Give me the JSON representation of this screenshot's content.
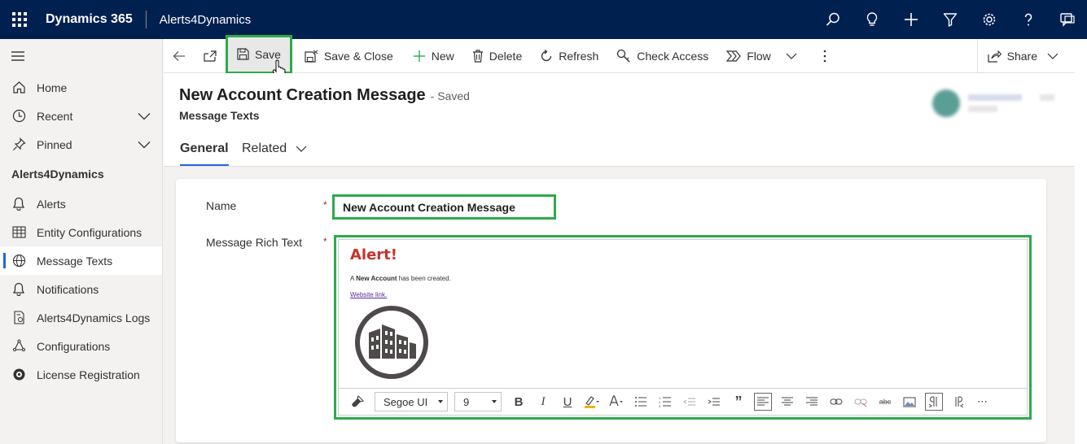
{
  "app": {
    "product": "Dynamics 365",
    "name": "Alerts4Dynamics"
  },
  "top_icons": [
    "search-icon",
    "lightbulb-icon",
    "plus-icon",
    "filter-icon",
    "settings-icon",
    "help-icon",
    "chat-icon"
  ],
  "commands": {
    "back": "back-arrow-icon",
    "popout": "popout-icon",
    "save": "Save",
    "save_close": "Save & Close",
    "new": "New",
    "delete": "Delete",
    "refresh": "Refresh",
    "check_access": "Check Access",
    "flow": "Flow",
    "share": "Share"
  },
  "sidebar": {
    "items_top": [
      {
        "label": "Home",
        "icon": "home-icon"
      },
      {
        "label": "Recent",
        "icon": "clock-icon"
      },
      {
        "label": "Pinned",
        "icon": "pin-icon"
      }
    ],
    "group_title": "Alerts4Dynamics",
    "items": [
      {
        "label": "Alerts",
        "icon": "bell-icon"
      },
      {
        "label": "Entity Configurations",
        "icon": "table-icon"
      },
      {
        "label": "Message Texts",
        "icon": "globe-icon"
      },
      {
        "label": "Notifications",
        "icon": "bell-icon"
      },
      {
        "label": "Alerts4Dynamics Logs",
        "icon": "log-icon"
      },
      {
        "label": "Configurations",
        "icon": "config-icon"
      },
      {
        "label": "License Registration",
        "icon": "license-icon"
      }
    ]
  },
  "form": {
    "title": "New Account Creation Message",
    "status": "- Saved",
    "entity": "Message Texts",
    "tabs": {
      "general": "General",
      "related": "Related"
    }
  },
  "fields": {
    "name_label": "Name",
    "name_value": "New Account Creation Message",
    "required_marker": "*",
    "rich_text_label": "Message Rich Text",
    "rich_text": {
      "heading": "Alert!",
      "line_prefix": "A",
      "line_bold": "New Account",
      "line_suffix": "has been created.",
      "link": "Website link."
    }
  },
  "editor_toolbar": {
    "font": "Segoe UI",
    "size": "9"
  },
  "colors": {
    "topbar": "#002050",
    "highlight": "#2eaa4a",
    "accent": "#2266e3",
    "alert_red": "#c8322b"
  }
}
